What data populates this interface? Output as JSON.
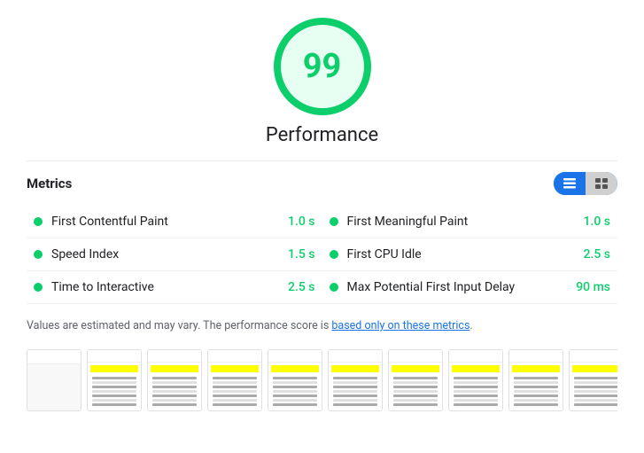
{
  "score": {
    "value": "99",
    "label": "Performance"
  },
  "metrics_header": {
    "title": "Metrics"
  },
  "metrics": [
    {
      "name": "First Contentful Paint",
      "value": "1.0 s",
      "color": "#0cce6b"
    },
    {
      "name": "First Meaningful Paint",
      "value": "1.0 s",
      "color": "#0cce6b"
    },
    {
      "name": "Speed Index",
      "value": "1.5 s",
      "color": "#0cce6b"
    },
    {
      "name": "First CPU Idle",
      "value": "2.5 s",
      "color": "#0cce6b"
    },
    {
      "name": "Time to Interactive",
      "value": "2.5 s",
      "color": "#0cce6b"
    },
    {
      "name": "Max Potential First Input Delay",
      "value": "90 ms",
      "color": "#0cce6b"
    }
  ],
  "notice": {
    "text_before": "Values are estimated and may vary. The performance score is ",
    "link_text": "based only on these metrics",
    "text_after": "."
  },
  "thumbnails": [
    {
      "blank": true
    },
    {
      "blank": false
    },
    {
      "blank": false
    },
    {
      "blank": false
    },
    {
      "blank": false
    },
    {
      "blank": false
    },
    {
      "blank": false
    },
    {
      "blank": false
    },
    {
      "blank": false
    },
    {
      "blank": false
    },
    {
      "blank": false
    }
  ]
}
